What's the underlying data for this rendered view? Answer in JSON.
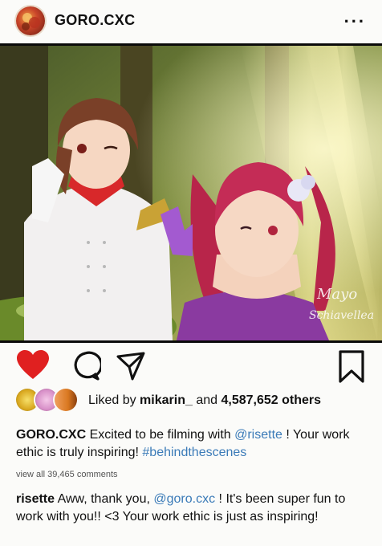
{
  "header": {
    "username": "GORO.CXC",
    "more_label": "..."
  },
  "post_image": {
    "signature_text": "Mayo Schiavellea"
  },
  "actions": {
    "liked": true,
    "like_color": "#e02020"
  },
  "likes": {
    "prefix": "Liked by",
    "user": "mikarin_",
    "middle": "and",
    "count": "4,587,652 others"
  },
  "caption": {
    "user": "GORO.CXC",
    "text_1": "Excited to be filming with",
    "mention": "@risette",
    "text_2": "! Your work ethic is truly inspiring!",
    "hashtag": "#behindthescenes"
  },
  "view_comments": "view all 39,465 comments",
  "comment": {
    "user": "risette",
    "text_1": "Aww, thank you,",
    "mention": "@goro.cxc",
    "text_2": "! It's been super fun to work with you!! <3 Your work ethic is just as inspiring!"
  }
}
